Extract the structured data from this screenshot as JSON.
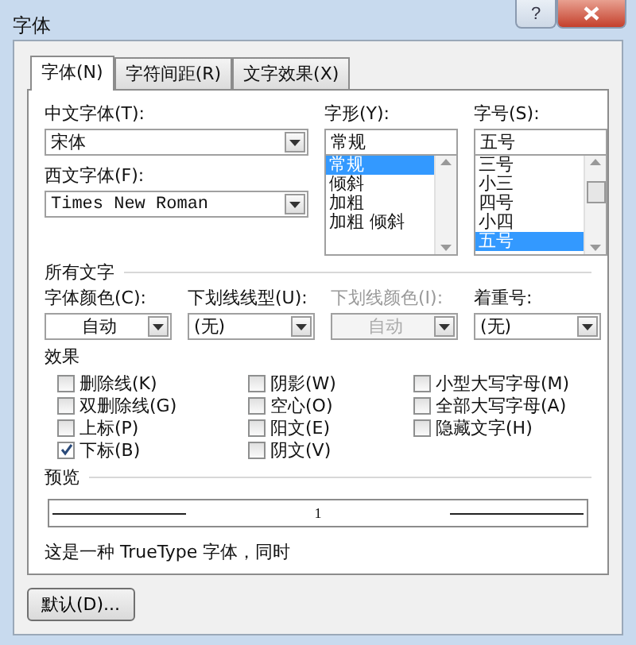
{
  "window": {
    "title": "字体",
    "help": "?"
  },
  "tabs": [
    {
      "label": "字体(N)",
      "selected": true
    },
    {
      "label": "字符间距(R)",
      "selected": false
    },
    {
      "label": "文字效果(X)",
      "selected": false
    }
  ],
  "chinese_font": {
    "label": "中文字体(T):",
    "value": "宋体"
  },
  "western_font": {
    "label": "西文字体(F):",
    "value": "Times New Roman"
  },
  "font_style": {
    "label": "字形(Y):",
    "value": "常规",
    "items": [
      {
        "label": "常规",
        "selected": true
      },
      {
        "label": "倾斜",
        "selected": false
      },
      {
        "label": "加粗",
        "selected": false
      },
      {
        "label": "加粗 倾斜",
        "selected": false
      }
    ]
  },
  "font_size": {
    "label": "字号(S):",
    "value": "五号",
    "items": [
      {
        "label": "三号",
        "selected": false
      },
      {
        "label": "小三",
        "selected": false
      },
      {
        "label": "四号",
        "selected": false
      },
      {
        "label": "小四",
        "selected": false
      },
      {
        "label": "五号",
        "selected": true
      }
    ]
  },
  "all_text": {
    "title": "所有文字",
    "fields": [
      {
        "label": "字体颜色(C):",
        "value": "自动",
        "kind": "color",
        "disabled": false
      },
      {
        "label": "下划线线型(U):",
        "value": "(无)",
        "kind": "list",
        "disabled": false
      },
      {
        "label": "下划线颜色(I):",
        "value": "自动",
        "kind": "color",
        "disabled": true
      },
      {
        "label": "着重号:",
        "value": "(无)",
        "kind": "list",
        "disabled": false
      }
    ]
  },
  "effects": {
    "title": "效果",
    "columns": [
      [
        {
          "label": "删除线(K)",
          "checked": false
        },
        {
          "label": "双删除线(G)",
          "checked": false
        },
        {
          "label": "上标(P)",
          "checked": false
        },
        {
          "label": "下标(B)",
          "checked": true
        }
      ],
      [
        {
          "label": "阴影(W)",
          "checked": false
        },
        {
          "label": "空心(O)",
          "checked": false
        },
        {
          "label": "阳文(E)",
          "checked": false
        },
        {
          "label": "阴文(V)",
          "checked": false
        }
      ],
      [
        {
          "label": "小型大写字母(M)",
          "checked": false
        },
        {
          "label": "全部大写字母(A)",
          "checked": false
        },
        {
          "label": "隐藏文字(H)",
          "checked": false
        }
      ]
    ]
  },
  "preview": {
    "title": "预览",
    "sample": "1"
  },
  "note": "这是一种 TrueType 字体，同时",
  "default_button": "默认(D)..."
}
